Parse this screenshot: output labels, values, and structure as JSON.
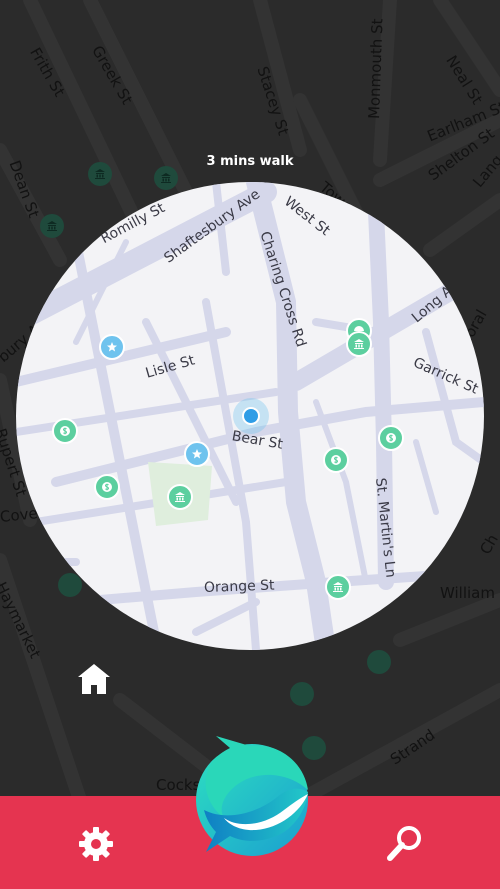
{
  "walk_label": "3 mins walk",
  "map": {
    "dark_streets": [
      "Frith St",
      "Greek St",
      "Stacey St",
      "Monmouth St",
      "Neal St",
      "Earlham St",
      "Dean St",
      "Shelton St",
      "Lang",
      "Tower St",
      "Rupert St",
      "Coventry St",
      "Haymarket",
      "Strand",
      "Floral",
      "William",
      "Cocks",
      "bury Ave",
      "Ch"
    ],
    "streets": [
      "Romilly St",
      "Shaftesbury Ave",
      "West St",
      "Charing Cross Rd",
      "Long Acre",
      "Lisle St",
      "Garrick St",
      "Bear St",
      "St. Martin's Ln",
      "Orange St"
    ]
  },
  "colors": {
    "background": "#2b2b2b",
    "map_circle": "#f3f3f6",
    "road": "#d5d7ea",
    "pin_green": "#5ccf9f",
    "pin_blue": "#6fc3ee",
    "location_dot": "#2f9de6",
    "bottom_bar": "#e53450"
  },
  "icons": {
    "home": "home-icon",
    "settings": "gear-icon",
    "search": "search-icon",
    "logo": "app-logo-icon"
  }
}
